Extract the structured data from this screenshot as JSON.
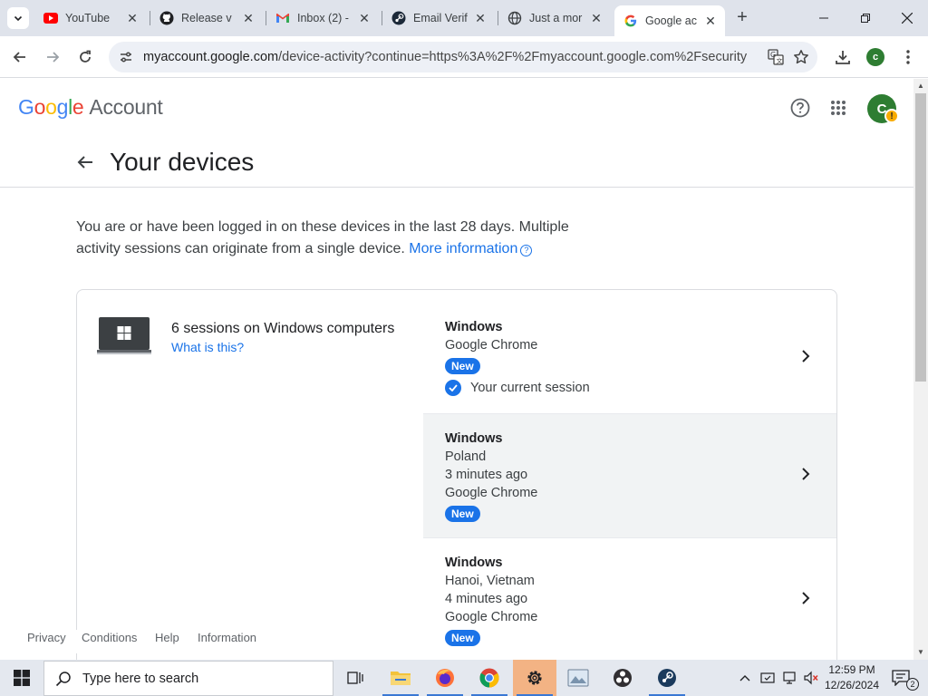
{
  "browser": {
    "tabs": [
      {
        "title": "YouTube",
        "icon": "youtube-icon"
      },
      {
        "title": "Release v",
        "icon": "github-icon"
      },
      {
        "title": "Inbox (2) -",
        "icon": "gmail-icon"
      },
      {
        "title": "Email Verif",
        "icon": "steam-icon"
      },
      {
        "title": "Just a mor",
        "icon": "globe-icon"
      },
      {
        "title": "Google ac",
        "icon": "google-icon",
        "active": true
      }
    ],
    "new_tab_label": "+",
    "url_host": "myaccount.google.com",
    "url_path": "/device-activity?continue=https%3A%2F%2Fmyaccount.google.com%2Fsecurity",
    "profile_initial": "c"
  },
  "header": {
    "logo_letters": [
      "G",
      "o",
      "o",
      "g",
      "l",
      "e"
    ],
    "logo_suffix": "Account",
    "avatar_initial": "C",
    "avatar_warning": "!"
  },
  "page": {
    "title": "Your devices",
    "intro_text": "You are or have been logged in on these devices in the last 28 days. Multiple activity sessions can originate from a single device.",
    "intro_link": "More information",
    "help_glyph": "?"
  },
  "device_group": {
    "title": "6 sessions on Windows computers",
    "link": "What is this?",
    "sessions": [
      {
        "os": "Windows",
        "lines": [
          "Google Chrome"
        ],
        "badge": "New",
        "current": "Your current session"
      },
      {
        "os": "Windows",
        "lines": [
          "Poland",
          "3 minutes ago",
          "Google Chrome"
        ],
        "badge": "New",
        "highlighted": true
      },
      {
        "os": "Windows",
        "lines": [
          "Hanoi, Vietnam",
          "4 minutes ago",
          "Google Chrome"
        ],
        "badge": "New"
      }
    ]
  },
  "footer": {
    "links": [
      "Privacy",
      "Conditions",
      "Help",
      "Information"
    ]
  },
  "taskbar": {
    "search_placeholder": "Type here to search",
    "time": "12:59 PM",
    "date": "12/26/2024",
    "notification_count": "2"
  },
  "colors": {
    "accent": "#1a73e8",
    "badge_bg": "#1a73e8",
    "avatar_bg": "#2e7d32",
    "warning": "#f9ab00"
  }
}
